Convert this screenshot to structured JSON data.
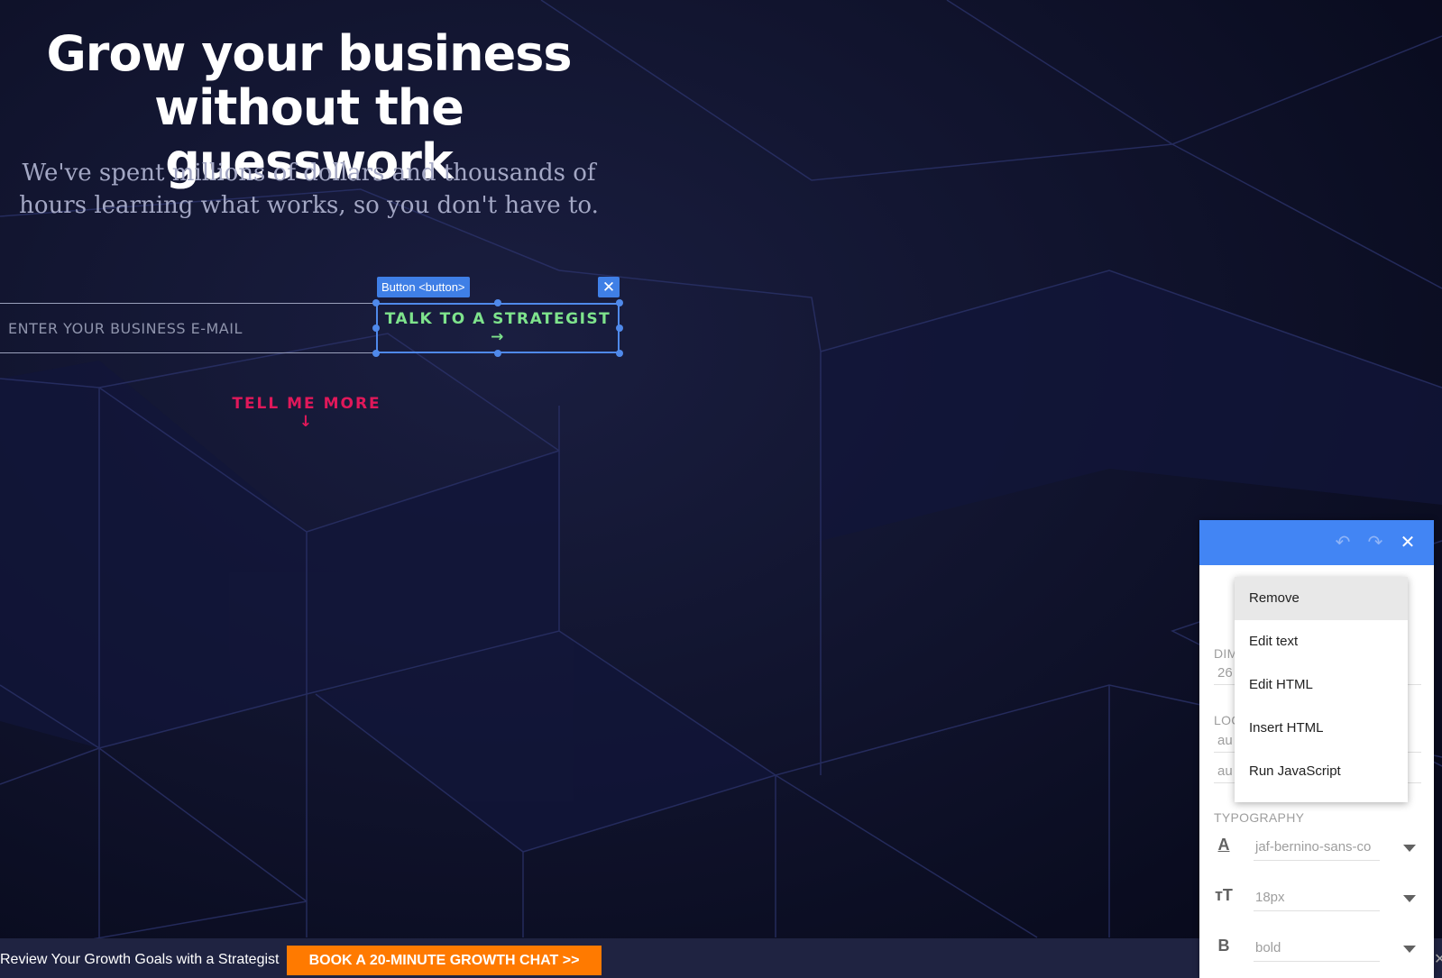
{
  "hero": {
    "title_line1": "Grow your business",
    "title_line2": "without the guesswork",
    "subtitle_line1": "We've spent millions of dollars and thousands of",
    "subtitle_line2": "hours learning what works, so you don't have to."
  },
  "form": {
    "email_placeholder": "ENTER YOUR BUSINESS E-MAIL",
    "cta_label": "TALK TO A STRATEGIST →"
  },
  "selection": {
    "tag": "Button <button>",
    "close_icon": "close-icon"
  },
  "tell_more": "TELL ME MORE ↓",
  "bottom_bar": {
    "text": "Review Your Growth Goals with a Strategist",
    "button": "BOOK A 20-MINUTE GROWTH CHAT >>"
  },
  "editor": {
    "undo_icon": "undo-icon",
    "redo_icon": "redo-icon",
    "dimensions_label": "DIM",
    "dimensions_value": "26",
    "location_label": "LOC",
    "location_value_1": "au",
    "location_value_2": "au",
    "typography_label": "TYPOGRAPHY",
    "font_family": "jaf-bernino-sans-co",
    "font_size": "18px",
    "font_weight": "bold"
  },
  "context_menu": {
    "items": [
      "Remove",
      "Edit text",
      "Edit HTML",
      "Insert HTML",
      "Run JavaScript"
    ],
    "active": "Remove"
  },
  "colors": {
    "background": "#0b0d22",
    "accent_blue": "#4285f4",
    "cta_green": "#7ee38c",
    "tell_more_pink": "#e0185a",
    "book_orange": "#ff7a00"
  }
}
